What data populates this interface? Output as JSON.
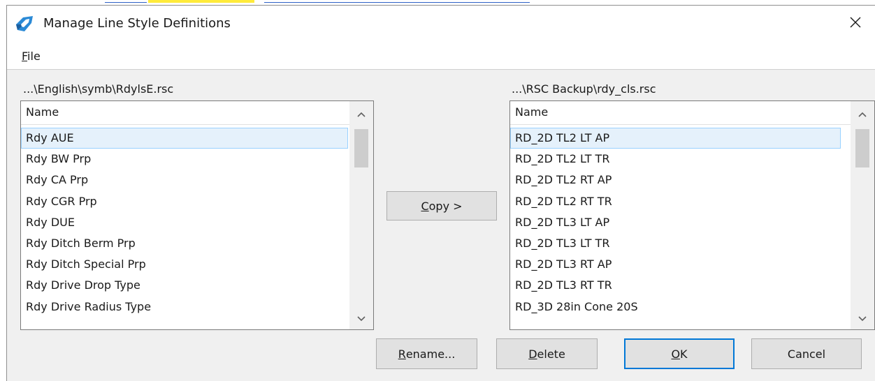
{
  "window": {
    "title": "Manage Line Style Definitions"
  },
  "menu": {
    "file": {
      "mnemonic": "F",
      "rest": "ile"
    }
  },
  "left_panel": {
    "path": "...\\English\\symb\\RdylsE.rsc",
    "column_header": "Name",
    "items": [
      "Rdy AUE",
      "Rdy BW Prp",
      "Rdy CA Prp",
      "Rdy CGR Prp",
      "Rdy DUE",
      "Rdy Ditch Berm Prp",
      "Rdy Ditch Special Prp",
      "Rdy Drive Drop Type",
      "Rdy Drive Radius Type"
    ],
    "selected_index": 0
  },
  "right_panel": {
    "path": "...\\RSC Backup\\rdy_cls.rsc",
    "column_header": "Name",
    "items": [
      "RD_2D TL2 LT AP",
      "RD_2D TL2 LT TR",
      "RD_2D TL2 RT AP",
      "RD_2D TL2 RT TR",
      "RD_2D TL3 LT AP",
      "RD_2D TL3 LT TR",
      "RD_2D TL3 RT AP",
      "RD_2D TL3 RT TR",
      "RD_3D 28in Cone 20S"
    ],
    "selected_index": 0
  },
  "buttons": {
    "copy": {
      "mnemonic": "C",
      "rest": "opy >"
    },
    "rename": {
      "mnemonic": "R",
      "rest": "ename..."
    },
    "delete": {
      "mnemonic": "D",
      "rest": "elete"
    },
    "ok": {
      "mnemonic": "O",
      "rest": "K"
    },
    "cancel": {
      "label": "Cancel"
    }
  },
  "icons": {
    "app": "app-logo-icon",
    "close": "close-icon",
    "scroll_up": "chevron-up-icon",
    "scroll_down": "chevron-down-icon"
  },
  "colors": {
    "selection_bg": "#e5f1fb",
    "selection_border": "#99d1ff",
    "default_button_border": "#0078d7",
    "dialog_bg": "#f0f0f0"
  }
}
